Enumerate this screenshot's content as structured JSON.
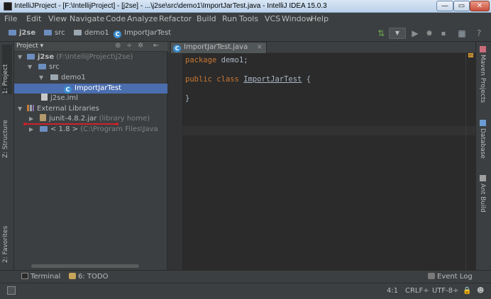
{
  "window": {
    "title": "IntelliJProject - [F:\\IntellijProject] - [j2se] - ...\\j2se\\src\\demo1\\ImportJarTest.java - IntelliJ IDEA 15.0.3",
    "min_glyph": "—",
    "max_glyph": "▭",
    "close_glyph": "✕"
  },
  "menu": [
    "File",
    "Edit",
    "View",
    "Navigate",
    "Code",
    "Analyze",
    "Refactor",
    "Build",
    "Run",
    "Tools",
    "VCS",
    "Window",
    "Help"
  ],
  "breadcrumbs": [
    "j2se",
    "src",
    "demo1",
    "ImportJarTest"
  ],
  "toolbar": {
    "run_config_glyph": "▼",
    "icons": [
      "build-icon",
      "run-icon",
      "debug-icon",
      "stop-icon",
      "project-structure-icon",
      "help-icon"
    ]
  },
  "left_strip": {
    "project_tab": "1: Project",
    "structure_tab": "Z: Structure",
    "favorites_tab": "2: Favorites"
  },
  "project_panel": {
    "view_selector": "Project",
    "tree": [
      {
        "label": "j2se",
        "extra": "(F:\\IntellijProject\\j2se)"
      },
      {
        "label": "src"
      },
      {
        "label": "demo1"
      },
      {
        "label": "ImportJarTest",
        "selected": true
      },
      {
        "label": "j2se.iml"
      },
      {
        "label": "External Libraries"
      },
      {
        "label": "junit-4.8.2.jar",
        "extra": "(library home)"
      },
      {
        "label": "< 1.8 >",
        "extra": "(C:\\Program Files\\Java"
      }
    ]
  },
  "editor": {
    "tab_label": "ImportJarTest.java",
    "tab_close": "×",
    "code": {
      "line1_kw": "package",
      "line1_rest": " demo1;",
      "line2_kw": "public class",
      "line2_name": "ImportJarTest",
      "line2_rest": " {",
      "line4": "}"
    },
    "marker": "m"
  },
  "right_strip": {
    "maven": "Maven Projects",
    "database": "Database",
    "ant": "Ant Build"
  },
  "bottom_bar": {
    "terminal": "Terminal",
    "todo": "6: TODO",
    "event_log": "Event Log"
  },
  "status": {
    "position": "4:1",
    "line_sep": "CRLF÷",
    "encoding": "UTF-8÷"
  },
  "colors": {
    "selection": "#4b6eaf",
    "keyword": "#cc7832",
    "editor_bg": "#2b2b2b",
    "panel_bg": "#3c3f41"
  }
}
